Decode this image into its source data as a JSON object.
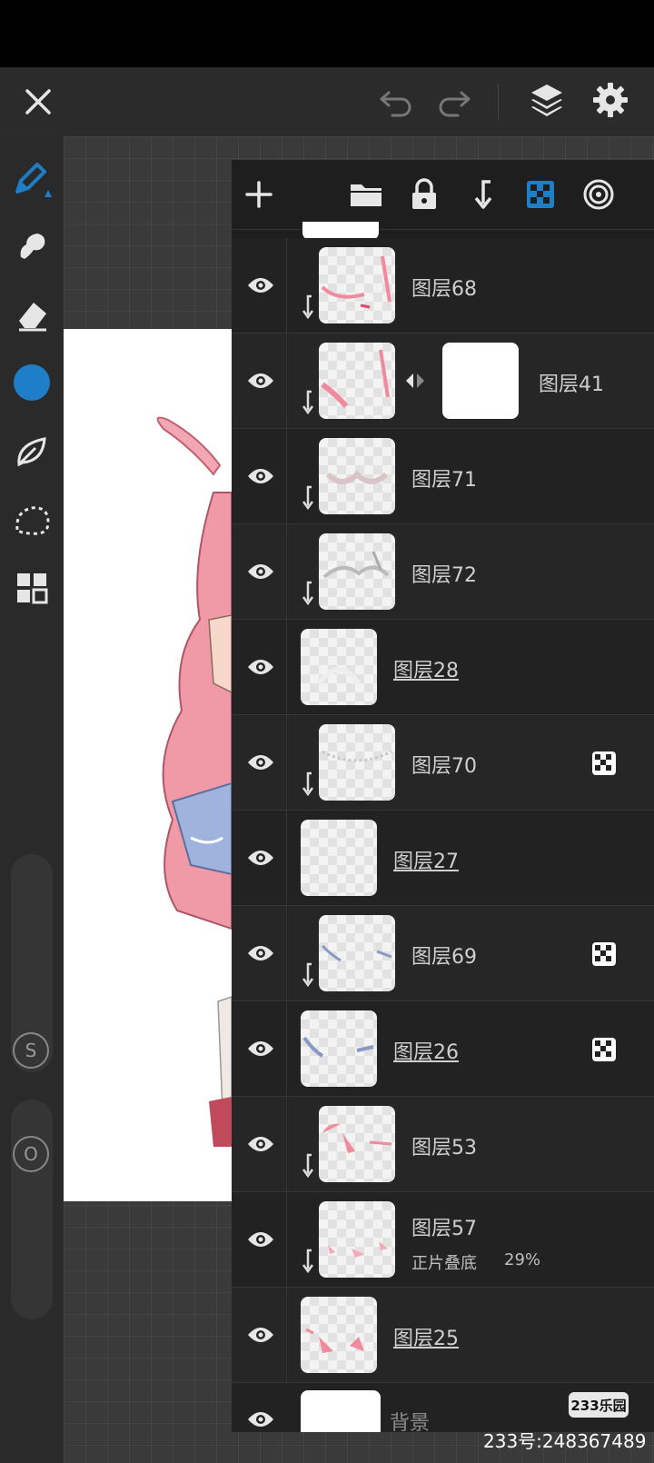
{
  "top_bar": {
    "close_icon": "close-icon",
    "undo_icon": "undo-icon",
    "redo_icon": "redo-icon",
    "layers_icon": "layers-icon",
    "settings_icon": "gear-icon"
  },
  "tools": {
    "items": [
      "brush",
      "smudge",
      "eraser",
      "color",
      "leaf",
      "lasso",
      "grid"
    ],
    "active": "brush",
    "active_color": "#1e7fc8",
    "size_slider_label": "S",
    "opacity_slider_label": "O"
  },
  "layer_panel": {
    "header_icons": [
      "add-layer-icon",
      "folder-icon",
      "lock-icon",
      "clip-down-icon",
      "alpha-lock-icon",
      "blend-icon"
    ],
    "layers": [
      {
        "name": "图层68",
        "clipped": true,
        "reference": false,
        "alpha_badge": false
      },
      {
        "name": "图层41",
        "clipped": true,
        "reference": false,
        "alpha_badge": false,
        "has_mask": true
      },
      {
        "name": "图层71",
        "clipped": true,
        "reference": false,
        "alpha_badge": false
      },
      {
        "name": "图层72",
        "clipped": true,
        "reference": false,
        "alpha_badge": false
      },
      {
        "name": "图层28",
        "clipped": false,
        "reference": true,
        "alpha_badge": false
      },
      {
        "name": "图层70",
        "clipped": true,
        "reference": false,
        "alpha_badge": true
      },
      {
        "name": "图层27",
        "clipped": false,
        "reference": true,
        "alpha_badge": false
      },
      {
        "name": "图层69",
        "clipped": true,
        "reference": false,
        "alpha_badge": true
      },
      {
        "name": "图层26",
        "clipped": false,
        "reference": true,
        "alpha_badge": true
      },
      {
        "name": "图层53",
        "clipped": true,
        "reference": false,
        "alpha_badge": false
      },
      {
        "name": "图层57",
        "clipped": true,
        "reference": false,
        "alpha_badge": false,
        "blend_mode": "正片叠底",
        "opacity": "29%"
      },
      {
        "name": "图层25",
        "clipped": false,
        "reference": true,
        "alpha_badge": false
      }
    ],
    "background_layer": {
      "name": "背景"
    }
  },
  "watermark": {
    "logo": "233乐园",
    "text": "233号:248367489"
  }
}
